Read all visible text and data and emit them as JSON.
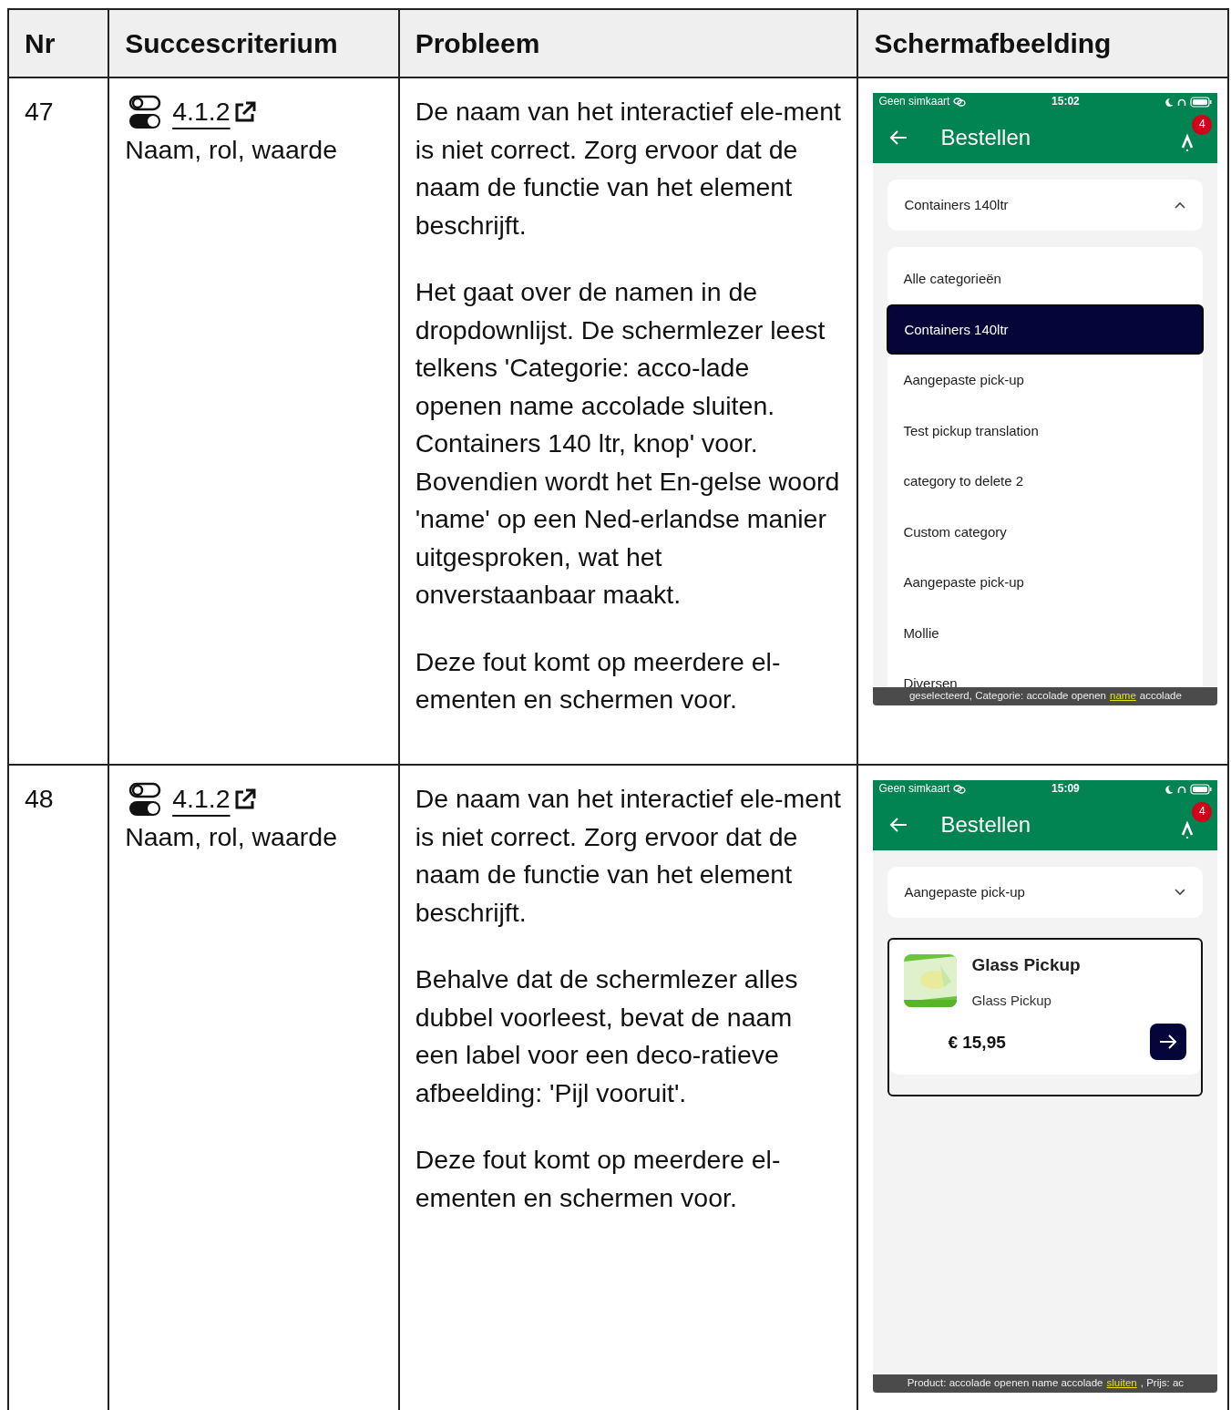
{
  "table": {
    "columns": [
      "Nr",
      "Succescriterium",
      "Probleem",
      "Schermafbeelding"
    ],
    "rows": [
      {
        "nr": "47",
        "criterion": {
          "link": "4.1.2",
          "name": "Naam, rol, waarde"
        },
        "problem": [
          "De naam van het interactief ele-ment is niet correct. Zorg ervoor dat de naam de functie van het element beschrijft.",
          "Het gaat over de namen in de dropdownlijst. De schermlezer leest telkens 'Categorie: acco-lade openen name accolade sluiten. Containers 140 ltr, knop' voor. Bovendien wordt het En-gelse woord 'name' op een Ned-erlandse manier uitgesproken, wat het onverstaanbaar maakt.",
          "Deze fout komt op meerdere el-ementen en schermen voor."
        ],
        "screenshot": {
          "carrier": "Geen simkaart",
          "time": "15:02",
          "title": "Bestellen",
          "badge": "4",
          "dropdown": {
            "value": "Containers 140ltr",
            "expanded": true
          },
          "options": [
            {
              "label": "Alle categorieën",
              "selected": false
            },
            {
              "label": "Containers 140ltr",
              "selected": true
            },
            {
              "label": "Aangepaste pick-up",
              "selected": false
            },
            {
              "label": "Test pickup translation",
              "selected": false
            },
            {
              "label": "category to delete 2",
              "selected": false
            },
            {
              "label": "Custom category",
              "selected": false
            },
            {
              "label": "Aangepaste pick-up",
              "selected": false
            },
            {
              "label": "Mollie",
              "selected": false
            },
            {
              "label": "Diversen",
              "selected": false
            }
          ],
          "caption": [
            {
              "text": "geselecteerd, Categorie: accolade openen",
              "highlighted": false
            },
            {
              "text": "name",
              "highlighted": true
            },
            {
              "text": "accolade",
              "highlighted": false
            }
          ]
        }
      },
      {
        "nr": "48",
        "criterion": {
          "link": "4.1.2",
          "name": "Naam, rol, waarde"
        },
        "problem": [
          "De naam van het interactief ele-ment is niet correct. Zorg ervoor dat de naam de functie van het element beschrijft.",
          "Behalve dat de schermlezer alles dubbel voorleest, bevat de naam een label voor een deco-ratieve afbeelding: 'Pijl vooruit'.",
          "Deze fout komt op meerdere el-ementen en schermen voor."
        ],
        "screenshot": {
          "carrier": "Geen simkaart",
          "time": "15:09",
          "title": "Bestellen",
          "badge": "4",
          "dropdown": {
            "value": "Aangepaste pick-up",
            "expanded": false
          },
          "products": [
            {
              "kind": "picture",
              "title": "Glass Pickup",
              "subtitle": "Glass Pickup",
              "price": "€ 15,95",
              "focused": true
            }
          ],
          "caption": [
            {
              "text": "Product: accolade openen name accolade",
              "highlighted": false
            },
            {
              "text": "sluiten",
              "highlighted": true
            },
            {
              "text": ", Prijs: ac",
              "highlighted": false
            }
          ]
        }
      }
    ]
  }
}
